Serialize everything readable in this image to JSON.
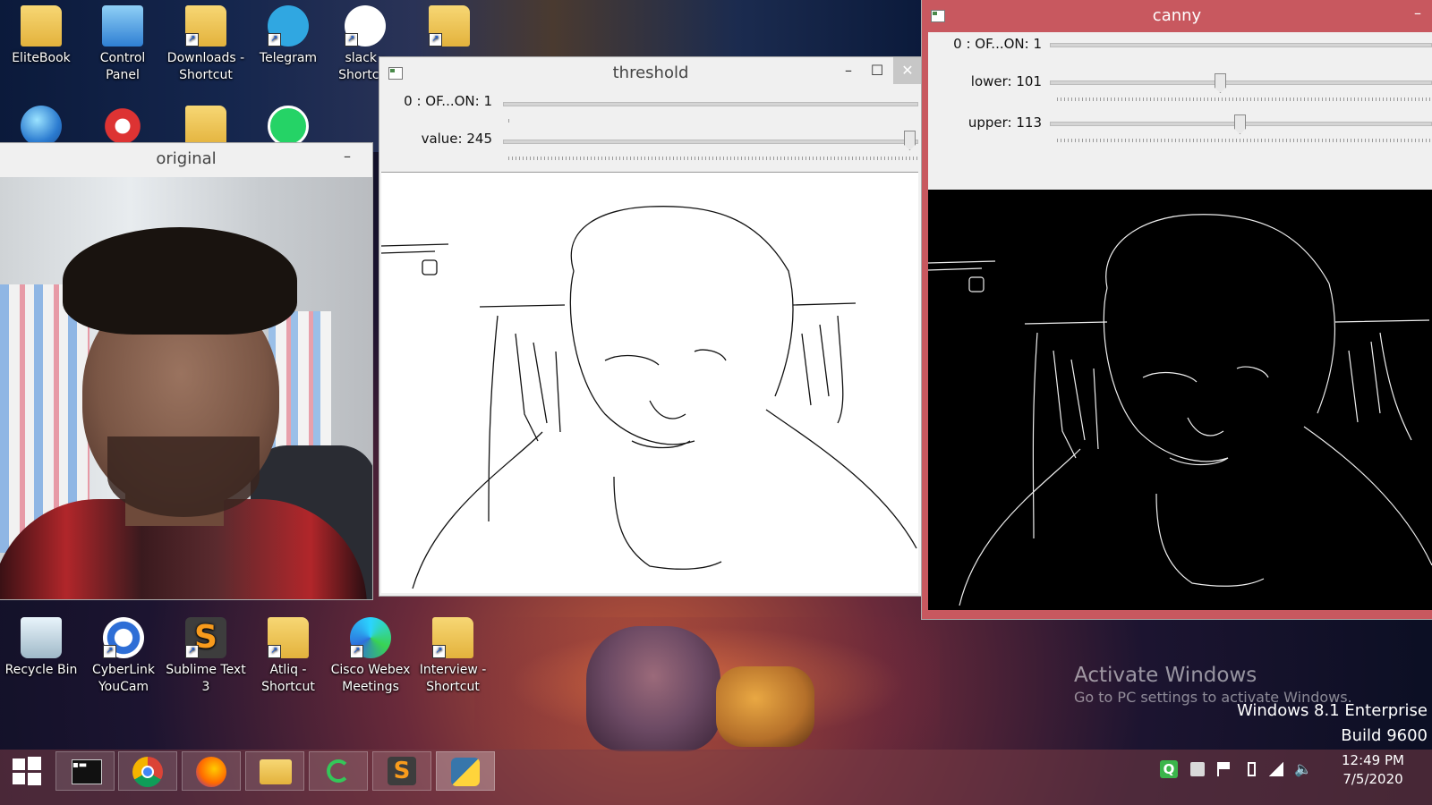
{
  "desktop": {
    "top_icons": [
      {
        "label": "EliteBook",
        "icon": "folder-user-icon"
      },
      {
        "label": "Control Panel",
        "icon": "control-panel-icon"
      },
      {
        "label": "Downloads - Shortcut",
        "icon": "downloads-folder-icon"
      },
      {
        "label": "Telegram",
        "icon": "telegram-icon"
      },
      {
        "label": "slack - Shortcut",
        "icon": "slack-icon"
      }
    ],
    "bottom_icons": [
      {
        "label": "Recycle Bin",
        "icon": "recycle-bin-icon"
      },
      {
        "label": "CyberLink YouCam",
        "icon": "youcam-icon"
      },
      {
        "label": "Sublime Text 3",
        "icon": "sublime-text-icon"
      },
      {
        "label": "Atliq - Shortcut",
        "icon": "folder-icon"
      },
      {
        "label": "Cisco Webex Meetings",
        "icon": "webex-icon"
      },
      {
        "label": "Interview - Shortcut",
        "icon": "folder-icon"
      }
    ],
    "watermark": {
      "title": "Activate Windows",
      "subtitle": "Go to PC settings to activate Windows.",
      "edition": "Windows 8.1 Enterprise",
      "build": "Build 9600"
    }
  },
  "windows": {
    "original": {
      "title": "original",
      "minimize": "–"
    },
    "threshold": {
      "title": "threshold",
      "minimize": "–",
      "maximize": "☐",
      "close": "✕",
      "trackbars": [
        {
          "label": "0 : OF...ON: 1",
          "value": 0,
          "max": 1
        },
        {
          "label": "value: 245",
          "value": 245,
          "max": 255
        }
      ]
    },
    "canny": {
      "title": "canny",
      "minimize": "–",
      "trackbars": [
        {
          "label": "0 : OF...ON: 1",
          "value": 0,
          "max": 1
        },
        {
          "label": "lower: 101",
          "value": 101,
          "max": 255
        },
        {
          "label": "upper: 113",
          "value": 113,
          "max": 255
        }
      ]
    }
  },
  "taskbar": {
    "pinned": [
      "start-icon",
      "terminal-icon",
      "chrome-icon",
      "firefox-icon",
      "file-explorer-icon",
      "spinner-app-icon",
      "sublime-text-icon",
      "python-icon"
    ],
    "clock": {
      "time": "12:49 PM",
      "date": "7/5/2020"
    },
    "tray_letter": "Q"
  },
  "colors": {
    "canny_frame": "#c8585f",
    "taskbar": "#7a3c46",
    "accent_blue": "#2e6ed6"
  }
}
